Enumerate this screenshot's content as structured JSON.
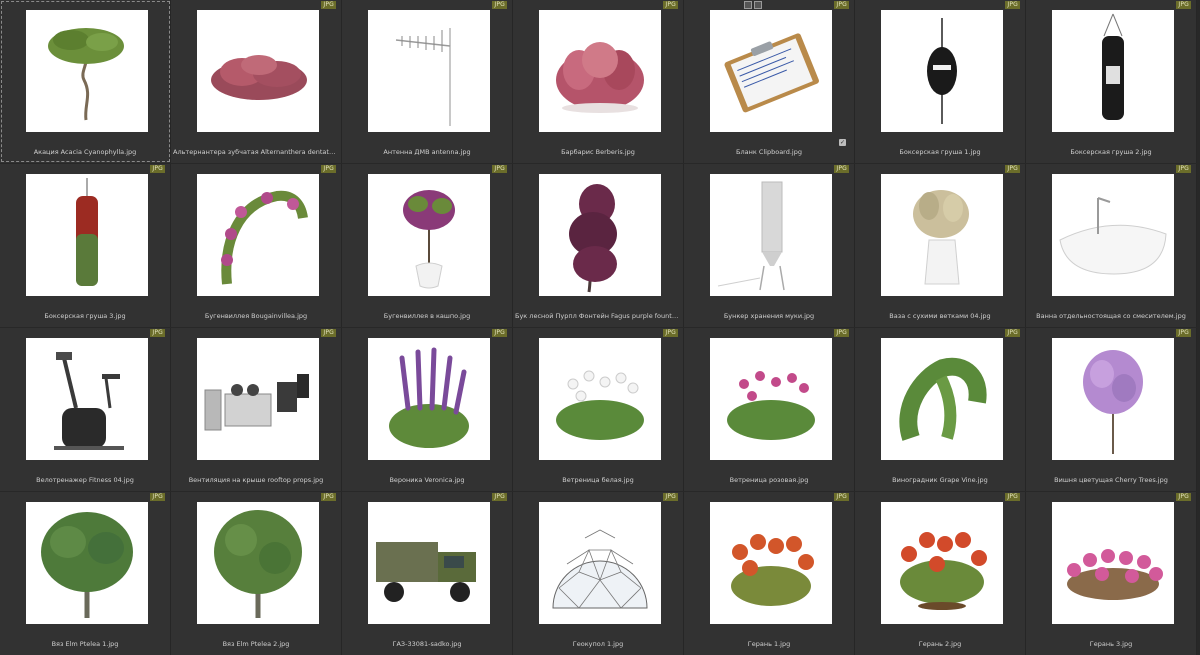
{
  "files": [
    {
      "name": "Акация Acacia Cyanophylla.jpg",
      "type": "JPG",
      "icon": "tree-icon"
    },
    {
      "name": "Альтернантера зубчатая Alternanthera dentata.jpg",
      "type": "JPG",
      "icon": "shrub-icon"
    },
    {
      "name": "Антенна ДМВ antenna.jpg",
      "type": "JPG",
      "icon": "antenna-icon"
    },
    {
      "name": "Барбарис Berberis.jpg",
      "type": "JPG",
      "icon": "shrub-icon"
    },
    {
      "name": "Бланк Clipboard.jpg",
      "type": "JPG",
      "icon": "clipboard-icon"
    },
    {
      "name": "Боксерская груша 1.jpg",
      "type": "JPG",
      "icon": "punching-bag-icon"
    },
    {
      "name": "Боксерская груша 2.jpg",
      "type": "JPG",
      "icon": "punching-bag-icon"
    },
    {
      "name": "Боксерская груша 3.jpg",
      "type": "JPG",
      "icon": "punching-bag-icon"
    },
    {
      "name": "Бугенвиллея Bougainvillea.jpg",
      "type": "JPG",
      "icon": "vine-icon"
    },
    {
      "name": "Бугенвиллея в кашпо.jpg",
      "type": "JPG",
      "icon": "potted-plant-icon"
    },
    {
      "name": "Бук лесной Пурпл Фонтейн Fagus purple fountain Weeping...",
      "type": "",
      "icon": "tree-icon"
    },
    {
      "name": "Бункер хранения муки.jpg",
      "type": "JPG",
      "icon": "silo-icon"
    },
    {
      "name": "Ваза с сухими ветками 04.jpg",
      "type": "JPG",
      "icon": "vase-icon"
    },
    {
      "name": "Ванна отдельностоящая со смесителем.jpg",
      "type": "JPG",
      "icon": "bathtub-icon"
    },
    {
      "name": "Велотренажер Fitness 04.jpg",
      "type": "JPG",
      "icon": "exercise-bike-icon"
    },
    {
      "name": "Вентиляция на крыше rooftop props.jpg",
      "type": "JPG",
      "icon": "ventilation-icon"
    },
    {
      "name": "Вероника Veronica.jpg",
      "type": "JPG",
      "icon": "flower-icon"
    },
    {
      "name": "Ветреница белая.jpg",
      "type": "JPG",
      "icon": "flower-icon"
    },
    {
      "name": "Ветреница розовая.jpg",
      "type": "JPG",
      "icon": "flower-icon"
    },
    {
      "name": "Виноградник Grape Vine.jpg",
      "type": "JPG",
      "icon": "vine-icon"
    },
    {
      "name": "Вишня цветущая Cherry Trees.jpg",
      "type": "JPG",
      "icon": "tree-icon"
    },
    {
      "name": "Вяз Elm Ptelea 1.jpg",
      "type": "JPG",
      "icon": "tree-icon"
    },
    {
      "name": "Вяз Elm Ptelea 2.jpg",
      "type": "JPG",
      "icon": "tree-icon"
    },
    {
      "name": "ГАЗ-33081-sadko.jpg",
      "type": "JPG",
      "icon": "truck-icon"
    },
    {
      "name": "Геокупол 1.jpg",
      "type": "JPG",
      "icon": "geodesic-dome-icon"
    },
    {
      "name": "Герань 1.jpg",
      "type": "JPG",
      "icon": "flower-icon"
    },
    {
      "name": "Герань 2.jpg",
      "type": "JPG",
      "icon": "flower-icon"
    },
    {
      "name": "Герань 3.jpg",
      "type": "JPG",
      "icon": "flower-icon"
    }
  ],
  "colors": {
    "background": "#282828",
    "cell": "#323232",
    "badge": "#6b6d2a",
    "caption": "#cfcfcf"
  }
}
